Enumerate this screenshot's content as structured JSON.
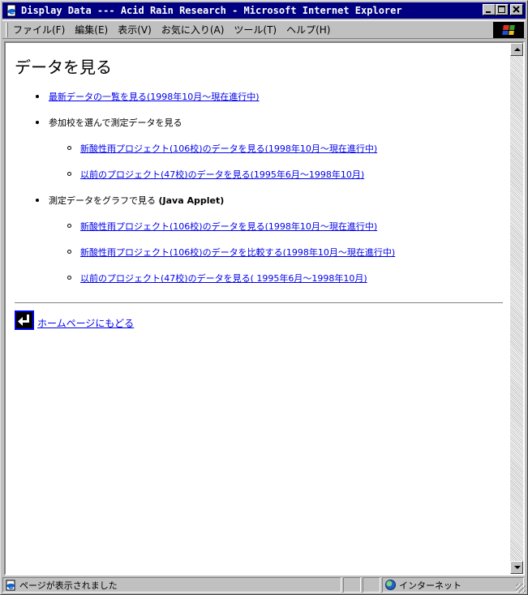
{
  "window": {
    "title": "Display Data --- Acid Rain Research - Microsoft Internet Explorer",
    "buttons": {
      "minimize": "_",
      "maximize": "□",
      "close": "×"
    }
  },
  "menu": {
    "items": [
      "ファイル(F)",
      "編集(E)",
      "表示(V)",
      "お気に入り(A)",
      "ツール(T)",
      "ヘルプ(H)"
    ]
  },
  "page": {
    "heading": "データを見る",
    "item1_link": "最新データの一覧を見る(1998年10月～現在進行中)",
    "item2_label": "参加校を選んで測定データを見る",
    "item2_sub1": "新酸性雨プロジェクト(106校)のデータを見る(1998年10月～現在進行中)",
    "item2_sub2": "以前のプロジェクト(47校)のデータを見る(1995年6月～1998年10月)",
    "item3_label": "測定データをグラフで見る",
    "item3_java": "(Java Applet)",
    "item3_sub1": "新酸性雨プロジェクト(106校)のデータを見る(1998年10月～現在進行中)",
    "item3_sub2": "新酸性雨プロジェクト(106校)のデータを比較する(1998年10月～現在進行中)",
    "item3_sub3": "以前のプロジェクト(47校)のデータを見る( 1995年6月～1998年10月)",
    "home_link": "ホームページにもどる"
  },
  "status": {
    "text": "ページが表示されました",
    "zone": "インターネット"
  },
  "colors": {
    "titlebar": "#000080",
    "link": "#0000ee",
    "chrome": "#c0c0c0"
  },
  "icons": {
    "title": "ie-page-icon",
    "status": "ie-page-icon",
    "zone": "globe-icon",
    "home": "return-arrow-icon"
  }
}
